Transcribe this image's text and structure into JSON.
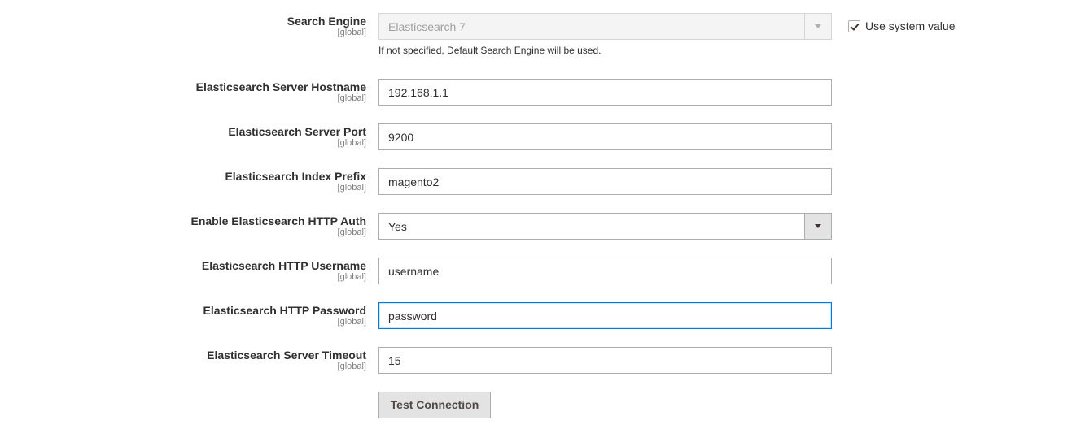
{
  "search_engine": {
    "label": "Search Engine",
    "scope": "[global]",
    "value": "Elasticsearch 7",
    "note": "If not specified, Default Search Engine will be used.",
    "use_system_value_label": "Use system value",
    "use_system_value_checked": true
  },
  "hostname": {
    "label": "Elasticsearch Server Hostname",
    "scope": "[global]",
    "value": "192.168.1.1"
  },
  "port": {
    "label": "Elasticsearch Server Port",
    "scope": "[global]",
    "value": "9200"
  },
  "index_prefix": {
    "label": "Elasticsearch Index Prefix",
    "scope": "[global]",
    "value": "magento2"
  },
  "http_auth": {
    "label": "Enable Elasticsearch HTTP Auth",
    "scope": "[global]",
    "value": "Yes"
  },
  "username": {
    "label": "Elasticsearch HTTP Username",
    "scope": "[global]",
    "value": "username"
  },
  "password": {
    "label": "Elasticsearch HTTP Password",
    "scope": "[global]",
    "value": "password"
  },
  "timeout": {
    "label": "Elasticsearch Server Timeout",
    "scope": "[global]",
    "value": "15"
  },
  "test_connection": {
    "label": "Test Connection"
  },
  "colors": {
    "focus_border": "#007bdb",
    "button_bg": "#e3e3e3",
    "disabled_bg": "#f4f4f4"
  }
}
